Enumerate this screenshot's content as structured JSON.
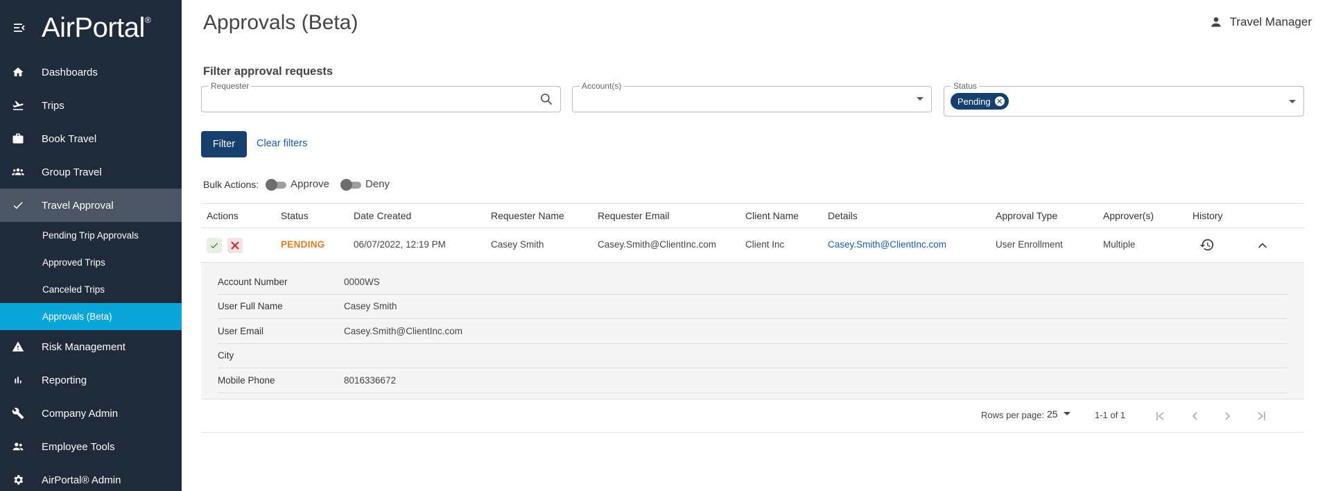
{
  "brand": {
    "name": "AirPortal",
    "reg": "®"
  },
  "sidebar": {
    "items": [
      {
        "label": "Dashboards",
        "icon": "home-icon"
      },
      {
        "label": "Trips",
        "icon": "plane-icon"
      },
      {
        "label": "Book Travel",
        "icon": "briefcase-icon"
      },
      {
        "label": "Group Travel",
        "icon": "group-icon"
      },
      {
        "label": "Travel Approval",
        "icon": "check-icon"
      },
      {
        "label": "Risk Management",
        "icon": "warning-icon"
      },
      {
        "label": "Reporting",
        "icon": "bar-chart-icon"
      },
      {
        "label": "Company Admin",
        "icon": "wrench-icon"
      },
      {
        "label": "Employee Tools",
        "icon": "people-icon"
      },
      {
        "label": "AirPortal® Admin",
        "icon": "gear-icon"
      }
    ],
    "subitems": [
      {
        "label": "Pending Trip Approvals"
      },
      {
        "label": "Approved Trips"
      },
      {
        "label": "Canceled Trips"
      },
      {
        "label": "Approvals (Beta)"
      }
    ]
  },
  "header": {
    "title": "Approvals (Beta)",
    "user": "Travel Manager"
  },
  "filters": {
    "title": "Filter approval requests",
    "requester_label": "Requester",
    "requester_value": "",
    "accounts_label": "Account(s)",
    "status_label": "Status",
    "status_chip": "Pending",
    "filter_button": "Filter",
    "clear_link": "Clear filters"
  },
  "bulk": {
    "label": "Bulk Actions:",
    "approve": "Approve",
    "deny": "Deny"
  },
  "table": {
    "columns": [
      "Actions",
      "Status",
      "Date Created",
      "Requester Name",
      "Requester Email",
      "Client Name",
      "Details",
      "Approval Type",
      "Approver(s)",
      "History"
    ],
    "rows": [
      {
        "status": "PENDING",
        "date": "06/07/2022, 12:19 PM",
        "name": "Casey Smith",
        "email": "Casey.Smith@ClientInc.com",
        "client": "Client Inc",
        "details": "Casey.Smith@ClientInc.com",
        "type": "User Enrollment",
        "approvers": "Multiple"
      }
    ],
    "detail": [
      {
        "k": "Account Number",
        "v": "0000WS"
      },
      {
        "k": "User Full Name",
        "v": "Casey Smith"
      },
      {
        "k": "User Email",
        "v": "Casey.Smith@ClientInc.com"
      },
      {
        "k": "City",
        "v": ""
      },
      {
        "k": "Mobile Phone",
        "v": "8016336672"
      }
    ]
  },
  "pager": {
    "rows_label": "Rows per page:",
    "rows_value": "25",
    "range": "1-1 of 1"
  },
  "colors": {
    "sidebar": "#1f2a3a",
    "accent": "#0aa5d9",
    "primary": "#163f6e",
    "pending": "#e87b1e"
  }
}
